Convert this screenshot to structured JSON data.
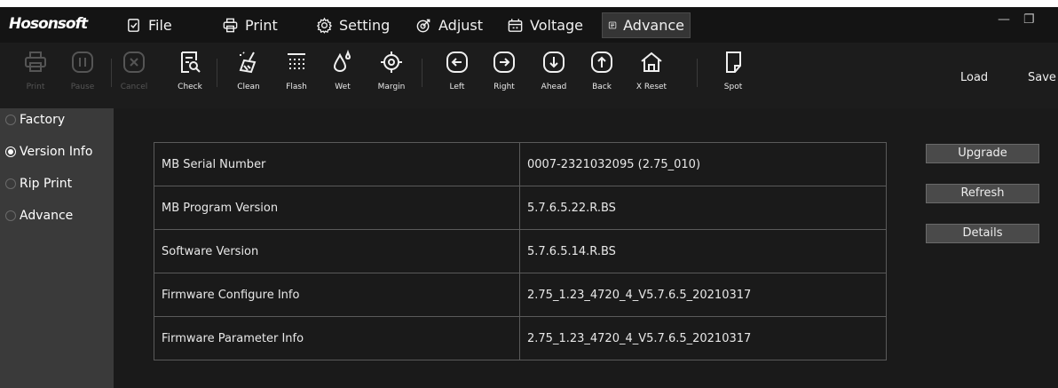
{
  "app": {
    "logo": "Hosonsoft"
  },
  "menu": {
    "items": [
      {
        "label": "File",
        "icon": "file-check-icon"
      },
      {
        "label": "Print",
        "icon": "printer-icon"
      },
      {
        "label": "Setting",
        "icon": "gear-icon"
      },
      {
        "label": "Adjust",
        "icon": "target-adjust-icon"
      },
      {
        "label": "Voltage",
        "icon": "voltage-icon"
      },
      {
        "label": "Advance",
        "icon": "advance-list-icon",
        "active": true
      }
    ]
  },
  "window_controls": {
    "minimize": "—",
    "restore": "❐"
  },
  "toolbar": {
    "tools": [
      {
        "label": "Print",
        "icon": "printer-icon",
        "enabled": false
      },
      {
        "label": "Pause",
        "icon": "pause-icon",
        "enabled": false
      },
      {
        "label": "Cancel",
        "icon": "cancel-icon",
        "enabled": false
      },
      {
        "label": "Check",
        "icon": "check-page-icon",
        "enabled": true
      },
      {
        "label": "Clean",
        "icon": "clean-brush-icon",
        "enabled": true
      },
      {
        "label": "Flash",
        "icon": "flash-grid-icon",
        "enabled": true
      },
      {
        "label": "Wet",
        "icon": "wet-drops-icon",
        "enabled": true
      },
      {
        "label": "Margin",
        "icon": "margin-target-icon",
        "enabled": true
      },
      {
        "label": "Left",
        "icon": "arrow-left-icon",
        "enabled": true
      },
      {
        "label": "Right",
        "icon": "arrow-right-icon",
        "enabled": true
      },
      {
        "label": "Ahead",
        "icon": "arrow-down-icon",
        "enabled": true
      },
      {
        "label": "Back",
        "icon": "arrow-up-icon",
        "enabled": true
      },
      {
        "label": "X Reset",
        "icon": "home-icon",
        "enabled": true
      },
      {
        "label": "Spot",
        "icon": "spot-page-icon",
        "enabled": true
      }
    ],
    "load_label": "Load",
    "save_label": "Save"
  },
  "sidebar": {
    "items": [
      {
        "label": "Factory",
        "selected": false
      },
      {
        "label": "Version Info",
        "selected": true
      },
      {
        "label": "Rip Print",
        "selected": false
      },
      {
        "label": "Advance",
        "selected": false
      }
    ]
  },
  "version_info": {
    "rows": [
      {
        "key": "MB Serial Number",
        "value": "0007-2321032095 (2.75_010)"
      },
      {
        "key": "MB Program Version",
        "value": "5.7.6.5.22.R.BS"
      },
      {
        "key": "Software Version",
        "value": "5.7.6.5.14.R.BS"
      },
      {
        "key": "Firmware Configure Info",
        "value": "2.75_1.23_4720_4_V5.7.6.5_20210317"
      },
      {
        "key": "Firmware Parameter Info",
        "value": "2.75_1.23_4720_4_V5.7.6.5_20210317"
      }
    ],
    "buttons": {
      "upgrade": "Upgrade",
      "refresh": "Refresh",
      "details": "Details"
    }
  },
  "colors": {
    "background": "#1a1a1a",
    "sidebar": "#3a3a3a",
    "active_menu": "#353535",
    "button": "#4a4a4a"
  }
}
